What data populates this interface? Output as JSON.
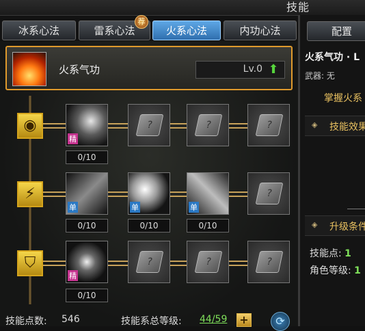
{
  "window": {
    "title": "技能"
  },
  "tabs": [
    {
      "label": "冰系心法"
    },
    {
      "label": "雷系心法"
    },
    {
      "label": "火系心法",
      "active": true
    },
    {
      "label": "内功心法"
    }
  ],
  "tab_badge": "荐",
  "selected_skill": {
    "name": "火系气功",
    "level": "Lv.0"
  },
  "tree": {
    "rows": [
      {
        "slots": [
          {
            "tag": "精",
            "count": "0/10"
          },
          {
            "locked": true
          },
          {
            "locked": true
          },
          {
            "locked": true
          }
        ]
      },
      {
        "slots": [
          {
            "tag": "单",
            "count": "0/10"
          },
          {
            "tag": "单",
            "count": "0/10"
          },
          {
            "tag": "单",
            "count": "0/10"
          },
          {
            "locked": true
          }
        ]
      },
      {
        "slots": [
          {
            "tag": "精",
            "count": "0/10"
          },
          {
            "locked": true
          },
          {
            "locked": true
          },
          {
            "locked": true
          }
        ]
      }
    ],
    "lock_glyph": "?"
  },
  "footer": {
    "points_label": "技能点数:",
    "points_value": "546",
    "total_label": "技能系总等级:",
    "total_value": "44/59",
    "plus_glyph": "+",
    "refresh_glyph": "⟳"
  },
  "right_panel": {
    "config_label": "配置",
    "title": "火系气功 · L",
    "weapon": "武器: 无",
    "desc": "掌握火系",
    "effect_label": "技能效果",
    "upgrade_label": "升级条件",
    "skill_points_label": "技能点:",
    "skill_points_value": "1",
    "role_level_label": "角色等级:",
    "role_level_value": "1"
  },
  "icons": {
    "category_1": "fire-ring-icon",
    "category_2": "flame-claw-icon",
    "category_3": "fire-shield-icon",
    "level_up": "green-up-arrow-icon"
  }
}
